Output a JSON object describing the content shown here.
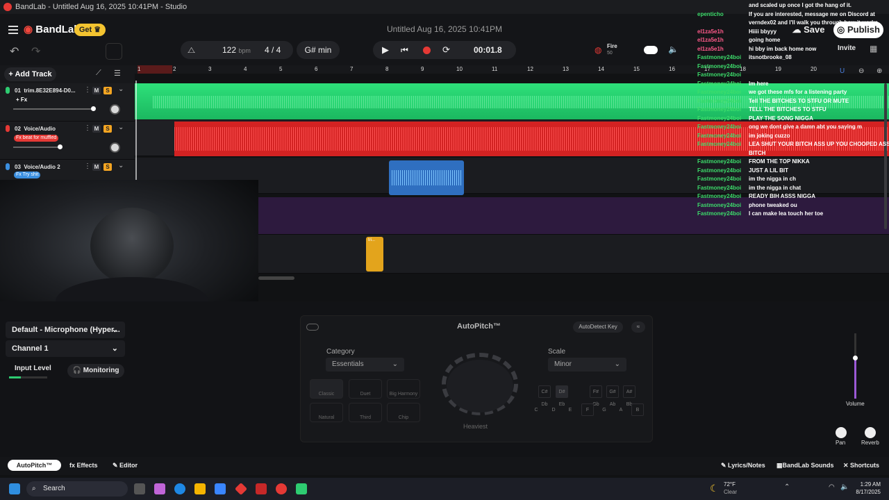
{
  "window_title": "BandLab - Untitled Aug 16, 2025 10:41PM - Studio",
  "header": {
    "logo": "BandLab",
    "get": "Get",
    "doc_title": "Untitled Aug 16, 2025 10:41PM",
    "save": "Save",
    "publish": "Publish"
  },
  "toolbar": {
    "bpm": "122",
    "bpm_unit": "bpm",
    "signature": "4 / 4",
    "key": "G# min",
    "time": "00:01.8",
    "fire": "Fire",
    "fire_sub": "50",
    "invite": "Invite"
  },
  "sidebar": {
    "add_track": "Add Track"
  },
  "tracks": [
    {
      "num": "01",
      "name": "trim.8E32E894-D0...",
      "fx": "+ Fx",
      "color": "#2ecc71",
      "vol": 0.95
    },
    {
      "num": "02",
      "name": "Voice/Audio",
      "fx": "Fx beat for muffled",
      "color": "#e53935",
      "vol": 0.6
    },
    {
      "num": "03",
      "name": "Voice/Audio 2",
      "fx": "Fx Try shit",
      "color": "#3b8fe0",
      "vol": 0.6
    }
  ],
  "ruler": [
    "1",
    "2",
    "3",
    "4",
    "5",
    "6",
    "7",
    "8",
    "9",
    "10",
    "11",
    "12",
    "13",
    "14",
    "15",
    "16",
    "17",
    "18",
    "19",
    "20"
  ],
  "clip_label": "tri...",
  "chat": [
    {
      "user": "",
      "msg": "and scaled up once I got the hang of it."
    },
    {
      "user": "epenticho",
      "msg": "If you are interested, message me on Discord at"
    },
    {
      "user": "",
      "msg": "verndex02 and I'll walk you through how it works."
    },
    {
      "user": "el1za5e1h",
      "msg": "Hiiii bbyyy",
      "pink": true
    },
    {
      "user": "el1za5e1h",
      "msg": "going home",
      "pink": true
    },
    {
      "user": "el1za5e1h",
      "msg": "hi bby im back home now",
      "pink": true
    },
    {
      "user": "Fastmoney24boi",
      "msg": "itsnotbrooke_08"
    },
    {
      "user": "Fastmoney24boi",
      "msg": ""
    },
    {
      "user": "Fastmoney24boi",
      "msg": ""
    },
    {
      "user": "Fastmoney24boi",
      "msg": "Im here"
    },
    {
      "user": "Fastmoney24boi",
      "msg": "we got these mfs for a listening party"
    },
    {
      "user": "Fastmoney24boi",
      "msg": "Tell THE BITCHES TO STFU OR MUTE"
    },
    {
      "user": "Fastmoney24boi",
      "msg": "TELL THE BITCHES TO STFU"
    },
    {
      "user": "Fastmoney24boi",
      "msg": "PLAY THE SONG NIGGA"
    },
    {
      "user": "Fastmoney24boi",
      "msg": "ong we dont give a damn abt you saying m"
    },
    {
      "user": "Fastmoney24boi",
      "msg": "im joking cuzzo"
    },
    {
      "user": "Fastmoney24boi",
      "msg": "LEA SHUT YOUR BITCH ASS UP YOU CHOOPED ASS"
    },
    {
      "user": "",
      "msg": "BITCH"
    },
    {
      "user": "Fastmoney24boi",
      "msg": "FROM THE TOP NIKKA"
    },
    {
      "user": "Fastmoney24boi",
      "msg": "JUST A LIL BIT"
    },
    {
      "user": "Fastmoney24boi",
      "msg": "im the nigga in ch"
    },
    {
      "user": "Fastmoney24boi",
      "msg": "im the nigga in chat"
    },
    {
      "user": "Fastmoney24boi",
      "msg": "READY BIH ASSS NIGGA"
    },
    {
      "user": "Fastmoney24boi",
      "msg": "phone tweaked ou"
    },
    {
      "user": "Fastmoney24boi",
      "msg": "I can make lea touch her toe"
    }
  ],
  "input": {
    "device": "Default - Microphone (Hyper...",
    "channel": "Channel 1",
    "level_label": "Input Level",
    "level": 0.3,
    "monitoring": "Monitoring"
  },
  "autopitch": {
    "title": "AutoPitch™",
    "autodetect": "AutoDetect Key",
    "category_label": "Category",
    "category": "Essentials",
    "scale_label": "Scale",
    "scale": "Minor",
    "dial_label": "Heaviest",
    "presets": [
      "Classic",
      "Duet",
      "Big Harmony",
      "Natural",
      "Third",
      "Chip"
    ],
    "keys_top": [
      "C#\nDb",
      "D#\nEb",
      "F#\nGb",
      "G#\nAb",
      "A#\nBb"
    ],
    "keys_bottom": [
      "C",
      "D",
      "E",
      "F",
      "G",
      "A",
      "B"
    ]
  },
  "mixer": {
    "volume": "Volume",
    "pan": "Pan",
    "reverb": "Reverb",
    "volume_level": 0.62
  },
  "bottom": {
    "autopitch": "AutoPitch™",
    "effects": "Effects",
    "editor": "Editor",
    "lyrics": "Lyrics/Notes",
    "sounds": "BandLab Sounds",
    "shortcuts": "Shortcuts"
  },
  "taskbar": {
    "search": "Search",
    "weather": "72°F",
    "weather_desc": "Clear",
    "time": "1:29 AM",
    "date": "8/17/2025"
  }
}
